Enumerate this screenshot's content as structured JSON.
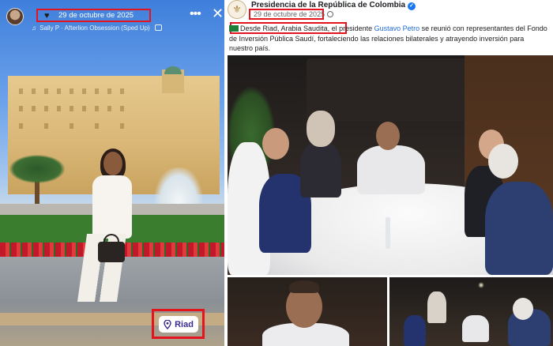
{
  "story": {
    "date": "29 de octubre de 2025",
    "music": "Sally P · Afterlion Obsession (Sped Up)",
    "location": "Riad",
    "icons": {
      "heart": "heart-icon",
      "more": "more-icon",
      "close": "close-icon",
      "pin": "location-pin-icon",
      "music": "music-note-icon"
    }
  },
  "post": {
    "page_name": "Presidencia de la República de Colombia",
    "date": "29 de octubre de 2025",
    "caption_prefix": "Desde Riad, Arabia Saudita,",
    "caption_mid": " el presidente ",
    "caption_tag": "Gustavo Petro",
    "caption_rest": " se reunió con representantes del Fondo de Inversión Pública Saudí, fortaleciendo las relaciones bilaterales y atrayendo inversión para nuestro país.",
    "colors": {
      "verified": "#1877f2",
      "tag": "#216fdb",
      "highlight": "#e3141e"
    }
  }
}
